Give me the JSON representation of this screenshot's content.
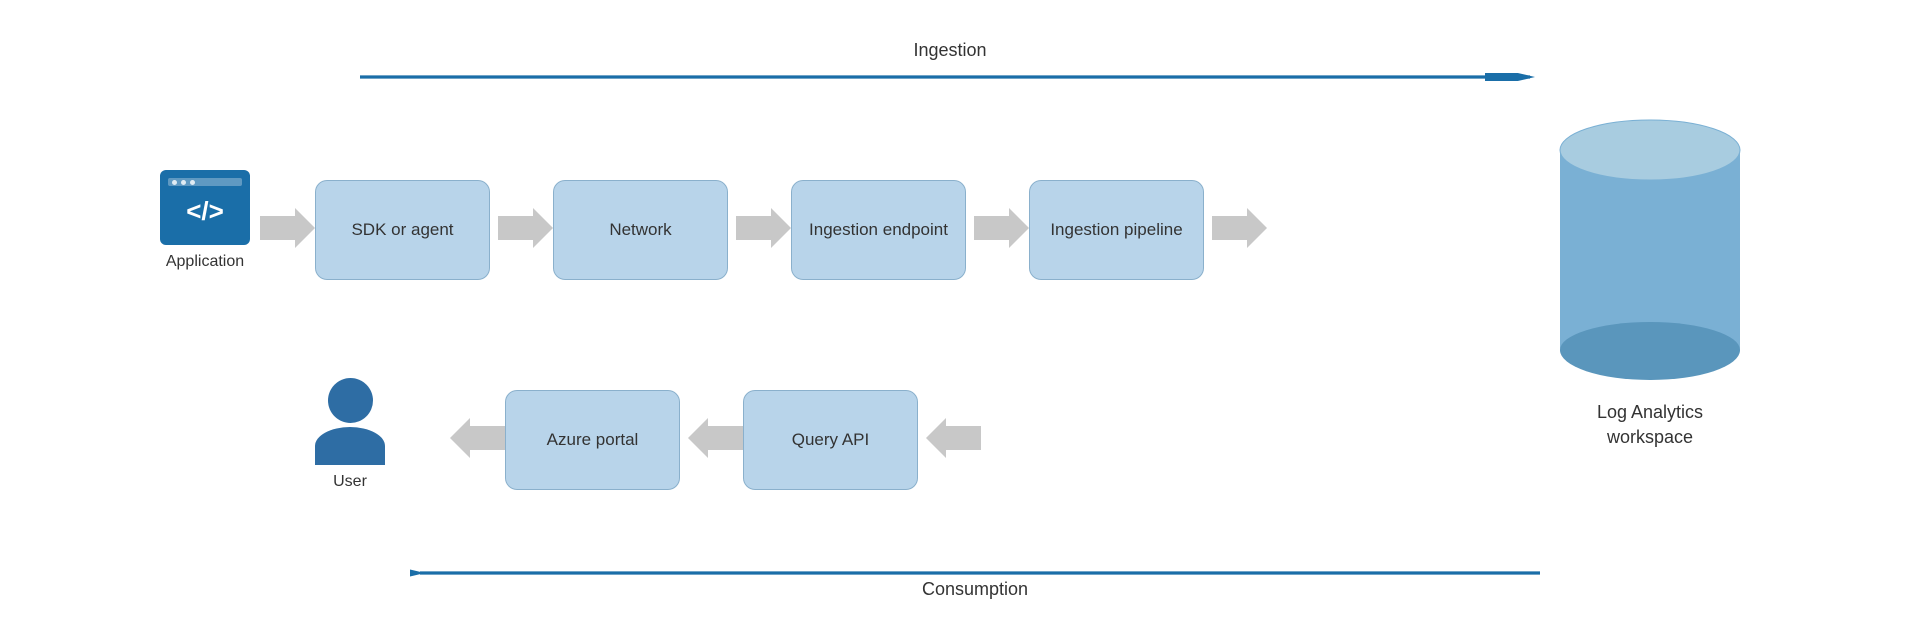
{
  "diagram": {
    "ingestion_label": "Ingestion",
    "consumption_label": "Consumption",
    "application_label": "Application",
    "user_label": "User",
    "db_label": "Log Analytics\nworkspace",
    "boxes": {
      "sdk_agent": "SDK or agent",
      "network": "Network",
      "ingestion_endpoint": "Ingestion\nendpoint",
      "ingestion_pipeline": "Ingestion\npipeline",
      "azure_portal": "Azure\nportal",
      "query_api": "Query API"
    },
    "colors": {
      "box_fill": "#b8d4ea",
      "box_border": "#8ab0cc",
      "arrow_blue": "#1a6ea8",
      "arrow_gray": "#b0b0b0",
      "app_blue": "#1a6ea8",
      "user_blue": "#2e6da4",
      "db_fill": "#7ab0d4",
      "db_top": "#a8cce0"
    }
  }
}
